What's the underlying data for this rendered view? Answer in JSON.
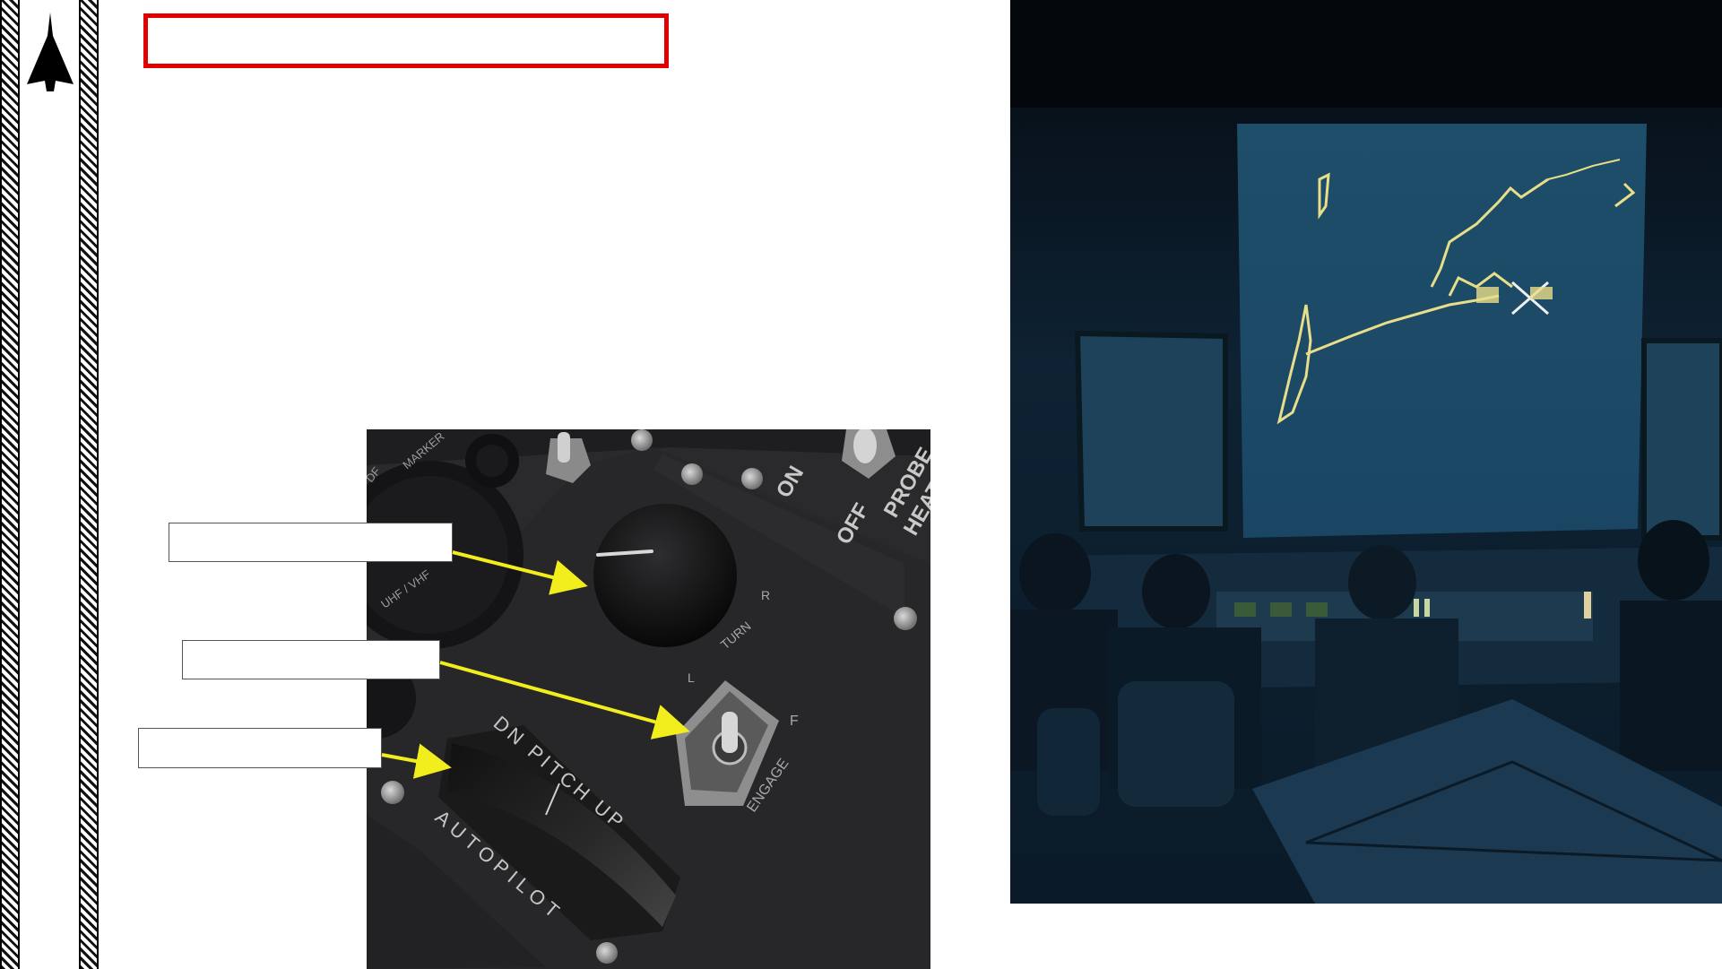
{
  "slide": {
    "title_box_text": "",
    "callouts": [
      {
        "label": ""
      },
      {
        "label": ""
      },
      {
        "label": ""
      }
    ]
  },
  "cockpit_panel": {
    "labels": {
      "marker": "MARKER",
      "df": "DF",
      "uhf": "UHF / VHF",
      "on": "ON",
      "off": "OFF",
      "probe": "PROBE",
      "probe_heat": "HEAT",
      "turn": "TURN",
      "turn_l": "L",
      "turn_r": "R",
      "pitch": "DN   PITCH   UP",
      "autopilot": "AUTOPILOT",
      "engage": "ENGAGE",
      "off_short": "F"
    }
  },
  "colors": {
    "accent_red": "#e00000",
    "arrow_yellow": "#f2ee1e",
    "panel_dark": "#2a2a2c",
    "radar_blue": "#0d1c2c"
  },
  "icons": {
    "logo": "delta-wing-jet-icon"
  }
}
